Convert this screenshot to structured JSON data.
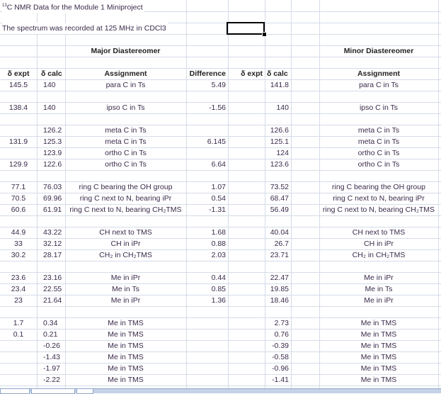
{
  "sheet": {
    "title_sup": "13",
    "title": "C NMR Data for the Module 1 Miniproject",
    "spectrum_note": "The spectrum was recorded at 125 MHz in CDCl3",
    "major_heading": "Major Diastereomer",
    "minor_heading": "Minor Diastereomer",
    "headers": [
      "δ expt",
      "δ calc",
      "Assignment",
      "Difference",
      "δ expt",
      "δ calc",
      "Assignment"
    ],
    "rows": [
      [],
      [],
      [],
      [],
      [],
      [],
      [],
      [
        "145.5",
        "140",
        "para C in Ts",
        "5.49",
        "",
        "",
        "141.8",
        "para C in Ts"
      ],
      [],
      [
        "138.4",
        "140",
        "ipso C in Ts",
        "-1.56",
        "",
        "",
        "140",
        "ipso C in Ts"
      ],
      [],
      [
        "",
        "126.2",
        "meta C in Ts",
        "",
        "",
        "",
        "126.6",
        "meta C in Ts"
      ],
      [
        "131.9",
        "125.3",
        "meta C in Ts",
        "6.145",
        "",
        "",
        "125.1",
        "meta C in Ts"
      ],
      [
        "",
        "123.9",
        "ortho C in Ts",
        "",
        "",
        "",
        "124",
        "ortho C in Ts"
      ],
      [
        "129.9",
        "122.6",
        "ortho C in Ts",
        "6.64",
        "",
        "",
        "123.6",
        "ortho C in Ts"
      ],
      [],
      [
        "77.1",
        "76.03",
        "ring C bearing the OH group",
        "1.07",
        "",
        "",
        "73.52",
        "ring C bearing the OH group"
      ],
      [
        "70.5",
        "69.96",
        "ring C next to N, bearing iPr",
        "0.54",
        "",
        "",
        "68.47",
        "ring C next to N, bearing iPr"
      ],
      [
        "60.6",
        "61.91",
        "ring C next to N, bearing CH₂TMS",
        "-1.31",
        "",
        "",
        "56.49",
        "ring C next to N, bearing CH₂TMS"
      ],
      [],
      [
        "44.9",
        "43.22",
        "CH next to TMS",
        "1.68",
        "",
        "",
        "40.04",
        "CH next to TMS"
      ],
      [
        "33",
        "32.12",
        "CH in iPr",
        "0.88",
        "",
        "",
        "26.7",
        "CH in iPr"
      ],
      [
        "30.2",
        "28.17",
        "CH₂ in CH₂TMS",
        "2.03",
        "",
        "",
        "23.71",
        "CH₂ in CH₂TMS"
      ],
      [],
      [
        "23.6",
        "23.16",
        "Me in iPr",
        "0.44",
        "",
        "",
        "22.47",
        "Me in iPr"
      ],
      [
        "23.4",
        "22.55",
        "Me in Ts",
        "0.85",
        "",
        "",
        "19.85",
        "Me in Ts"
      ],
      [
        "23",
        "21.64",
        "Me in iPr",
        "1.36",
        "",
        "",
        "18.46",
        "Me in iPr"
      ],
      [],
      [
        "1.7",
        "0.34",
        "Me in TMS",
        "",
        "",
        "",
        "2.73",
        "Me in TMS"
      ],
      [
        "0.1",
        "0.21",
        "Me in TMS",
        "",
        "",
        "",
        "0.76",
        "Me in TMS"
      ],
      [
        "",
        "-0.26",
        "Me in TMS",
        "",
        "",
        "",
        "-0.39",
        "Me in TMS"
      ],
      [
        "",
        "-1.43",
        "Me in TMS",
        "",
        "",
        "",
        "-0.58",
        "Me in TMS"
      ],
      [
        "",
        "-1.97",
        "Me in TMS",
        "",
        "",
        "",
        "-0.96",
        "Me in TMS"
      ],
      [
        "",
        "-2.22",
        "Me in TMS",
        "",
        "",
        "",
        "-1.41",
        "Me in TMS"
      ]
    ]
  }
}
